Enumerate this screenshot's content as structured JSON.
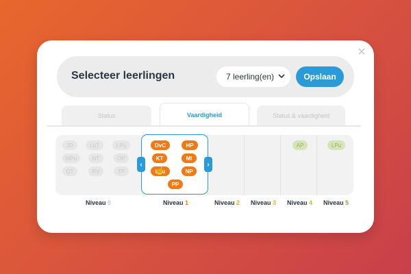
{
  "modal": {
    "close_label": "×",
    "title": "Selecteer leerlingen",
    "select_value": "7 leerling(en)",
    "save_label": "Opslaan"
  },
  "tabs": [
    {
      "label": "Status"
    },
    {
      "label": "Vaardigheid"
    },
    {
      "label": "Status & vaardigheid"
    }
  ],
  "levels": {
    "niveau0": {
      "chips": [
        "JD",
        "LqT",
        "LPu",
        "MPu",
        "NT",
        "OP",
        "QT",
        "RV",
        "TP"
      ]
    },
    "niveau1": {
      "chips": [
        "DvC",
        "HP",
        "KT",
        "MI",
        "LPu",
        "NP",
        "PP"
      ]
    },
    "niveau4": {
      "chips": [
        "AP"
      ]
    },
    "niveau5": {
      "chips": [
        "LPu"
      ]
    },
    "labels": [
      {
        "word": "Niveau",
        "num": "0"
      },
      {
        "word": "Niveau",
        "num": "1"
      },
      {
        "word": "Niveau",
        "num": "2"
      },
      {
        "word": "Niveau",
        "num": "3"
      },
      {
        "word": "Niveau",
        "num": "4"
      },
      {
        "word": "Niveau",
        "num": "5"
      }
    ]
  },
  "icons": {
    "prev": "‹",
    "next": "›",
    "chevron": "⌄",
    "cursor": "☝"
  },
  "colors": {
    "accent": "#2a9bd8",
    "chip_orange": "#f27a14",
    "chip_green": "#d7e4b6"
  }
}
